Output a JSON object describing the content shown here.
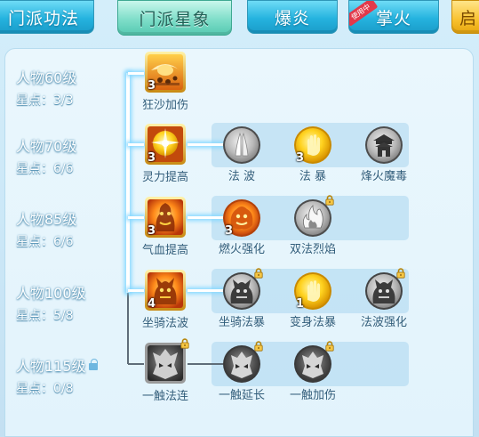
{
  "tabs": [
    {
      "label": "门派功法",
      "badge": ""
    },
    {
      "label": "门派星象",
      "badge": ""
    },
    {
      "label": "爆炎",
      "badge": ""
    },
    {
      "label": "掌火",
      "badge": "使用中"
    },
    {
      "label": "启",
      "badge": ""
    }
  ],
  "colors": {
    "tab_blue": "#25b3df",
    "tab_active": "#7fdec9",
    "tab_gold": "#f8c12e",
    "panel_bg": "#e2f3fc",
    "row_band": "#aad5ee",
    "lit_line": "#ffffff",
    "dim_line": "#5f6d79",
    "label_text": "#2e5c7a"
  },
  "levels": [
    {
      "title": "人物60级",
      "points": "星点：3/3",
      "locked": false
    },
    {
      "title": "人物70级",
      "points": "星点：6/6",
      "locked": false
    },
    {
      "title": "人物85级",
      "points": "星点：6/6",
      "locked": false
    },
    {
      "title": "人物100级",
      "points": "星点：5/8",
      "locked": false
    },
    {
      "title": "人物115级",
      "points": "星点：0/8",
      "locked": true
    }
  ],
  "rows": [
    {
      "main": {
        "name": "狂沙加伤",
        "count": "3",
        "icon": "sandstorm-icon",
        "locked": false
      },
      "subs": []
    },
    {
      "main": {
        "name": "灵力提高",
        "count": "3",
        "icon": "spirit-burst-icon",
        "locked": false
      },
      "subs": [
        {
          "name": "法 波",
          "count": "",
          "icon": "praying-hands-icon",
          "locked": false,
          "grey": true
        },
        {
          "name": "法 暴",
          "count": "3",
          "icon": "golden-hand-icon",
          "locked": false,
          "grey": false
        },
        {
          "name": "烽火魔毒",
          "count": "",
          "icon": "beacon-tower-icon",
          "locked": false,
          "grey": true
        }
      ]
    },
    {
      "main": {
        "name": "气血提高",
        "count": "3",
        "icon": "flame-warrior-icon",
        "locked": false
      },
      "subs": [
        {
          "name": "燃火强化",
          "count": "3",
          "icon": "fire-lion-icon",
          "locked": false,
          "grey": false
        },
        {
          "name": "双法烈焰",
          "count": "",
          "icon": "twin-flame-icon",
          "locked": true,
          "grey": true
        }
      ]
    },
    {
      "main": {
        "name": "坐骑法波",
        "count": "4",
        "icon": "mount-warrior-icon",
        "locked": false
      },
      "subs": [
        {
          "name": "坐骑法暴",
          "count": "",
          "icon": "mount-warrior-grey-icon",
          "locked": true,
          "grey": true
        },
        {
          "name": "变身法暴",
          "count": "1",
          "icon": "golden-hand-icon",
          "locked": false,
          "grey": false
        },
        {
          "name": "法波强化",
          "count": "",
          "icon": "mount-warrior-grey-icon",
          "locked": true,
          "grey": true
        }
      ]
    },
    {
      "main": {
        "name": "一触法连",
        "count": "",
        "icon": "demon-mask-icon",
        "locked": true
      },
      "subs": [
        {
          "name": "一触延长",
          "count": "",
          "icon": "demon-mask-icon",
          "locked": true,
          "grey": true
        },
        {
          "name": "一触加伤",
          "count": "",
          "icon": "demon-mask-icon",
          "locked": true,
          "grey": true
        }
      ]
    }
  ]
}
